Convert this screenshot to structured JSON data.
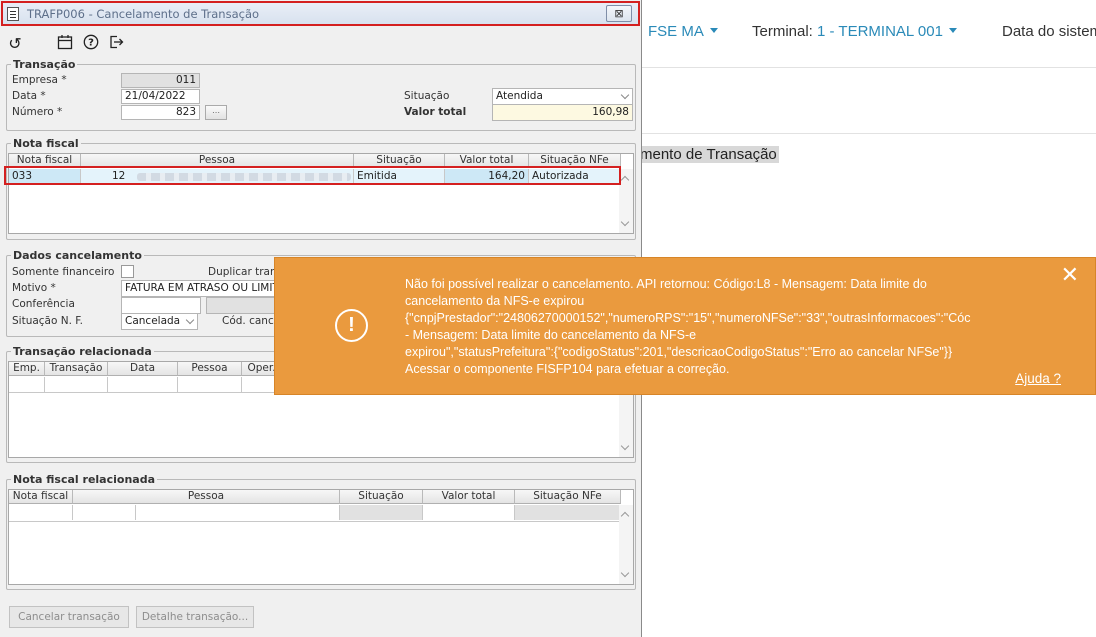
{
  "background": {
    "nav_item_1": "FSE MA",
    "terminal_label": "Terminal:",
    "terminal_value": "1 - TERMINAL 001",
    "date_label": "Data do sistema",
    "page_heading": "mento de Transação"
  },
  "dialog": {
    "title": "TRAFP006 - Cancelamento de Transação",
    "close_symbol": "⊠",
    "toolbar": {
      "icons": [
        "undo-icon",
        "calendar-icon",
        "help-icon",
        "exit-icon"
      ]
    },
    "transacao": {
      "legend": "Transação",
      "empresa_label": "Empresa *",
      "empresa_value": "011",
      "data_label": "Data *",
      "data_value": "21/04/2022",
      "numero_label": "Número *",
      "numero_value": "823",
      "situacao_label": "Situação",
      "situacao_value": "Atendida",
      "valor_total_label": "Valor total",
      "valor_total_value": "160,98"
    },
    "nota_fiscal": {
      "legend": "Nota fiscal",
      "columns": [
        "Nota fiscal",
        "Pessoa",
        "Situação",
        "Valor total",
        "Situação NFe"
      ],
      "rows": [
        {
          "nota": "033",
          "pessoa": "12",
          "situacao": "Emitida",
          "valor": "164,20",
          "situacao_nfe": "Autorizada"
        }
      ]
    },
    "dados_cancelamento": {
      "legend": "Dados cancelamento",
      "somente_financeiro_label": "Somente financeiro",
      "duplicar_label": "Duplicar trans",
      "motivo_label": "Motivo *",
      "motivo_value": "FATURA EM ATRASO OU LIMITE",
      "conferencia_label": "Conferência",
      "situacao_nf_label": "Situação N. F.",
      "situacao_nf_value": "Cancelada",
      "cod_canc_label": "Cód. canc."
    },
    "transacao_relacionada": {
      "legend": "Transação relacionada",
      "columns": [
        "Emp.",
        "Transação",
        "Data",
        "Pessoa",
        "Oper."
      ]
    },
    "nota_fiscal_relacionada": {
      "legend": "Nota fiscal relacionada",
      "columns": [
        "Nota fiscal",
        "Pessoa",
        "Situação",
        "Valor total",
        "Situação NFe"
      ]
    },
    "buttons": {
      "cancelar": "Cancelar transação",
      "detalhe": "Detalhe transação..."
    }
  },
  "toast": {
    "message": "Não foi possível realizar o cancelamento. API retornou: Código:L8 - Mensagem: Data limite do\ncancelamento da NFS-e expirou\n{\"cnpjPrestador\":\"24806270000152\",\"numeroRPS\":\"15\",\"numeroNFSe\":\"33\",\"outrasInformacoes\":\"Cóc\n- Mensagem: Data limite do cancelamento da NFS-e\nexpirou\",\"statusPrefeitura\":{\"codigoStatus\":201,\"descricaoCodigoStatus\":\"Erro ao cancelar NFSe\"}}\nAcessar o componente FISFP104 para efetuar a correção.",
    "help_link": "Ajuda ?",
    "close_symbol": "✕",
    "icon_symbol": "!",
    "color": "#ea9a3e"
  }
}
